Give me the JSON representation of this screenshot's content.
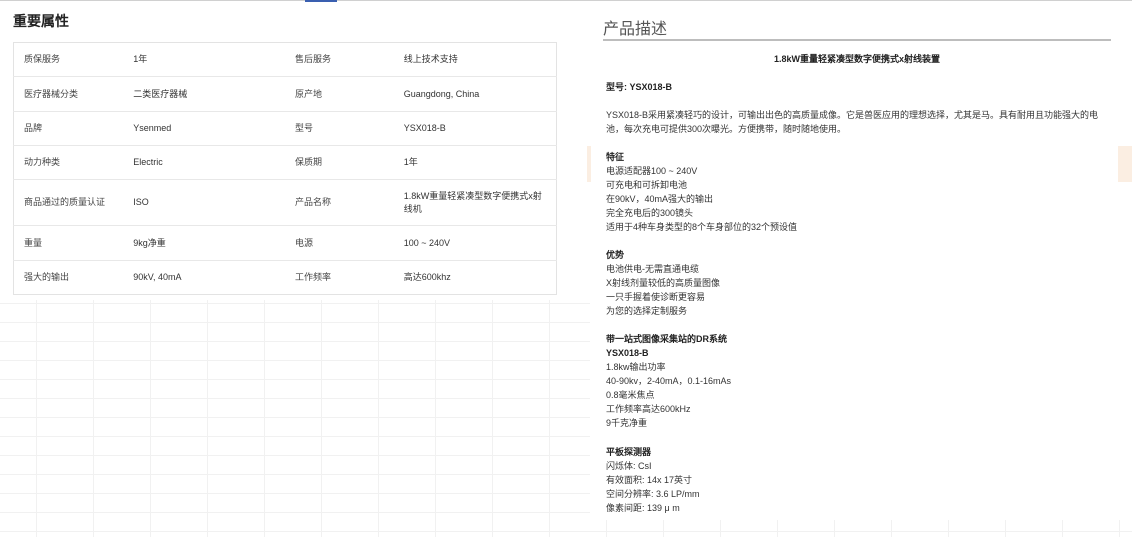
{
  "attributes": {
    "title": "重要属性",
    "rows": [
      {
        "k1": "质保服务",
        "v1": "1年",
        "k2": "售后服务",
        "v2": "线上技术支持"
      },
      {
        "k1": "医疗器械分类",
        "v1": "二类医疗器械",
        "k2": "原产地",
        "v2": "Guangdong, China"
      },
      {
        "k1": "品牌",
        "v1": "Ysenmed",
        "k2": "型号",
        "v2": "YSX018-B"
      },
      {
        "k1": "动力种类",
        "v1": "Electric",
        "k2": "保质期",
        "v2": "1年"
      },
      {
        "k1": "商品通过的质量认证",
        "v1": "ISO",
        "k2": "产品名称",
        "v2": "1.8kW重量轻紧凑型数字便携式x射线机"
      },
      {
        "k1": "重量",
        "v1": "9kg净重",
        "k2": "电源",
        "v2": "100 ~ 240V"
      },
      {
        "k1": "强大的输出",
        "v1": "90kV, 40mA",
        "k2": "工作频率",
        "v2": "高达600khz"
      }
    ]
  },
  "description": {
    "title": "产品描述",
    "heading": "1.8kW重量轻紧凑型数字便携式x射线装置",
    "model": "型号: YSX018-B",
    "intro": "YSX018-B采用紧凑轻巧的设计，可输出出色的高质量成像。它是兽医应用的理想选择，尤其是马。具有耐用且功能强大的电池，每次充电可提供300次曝光。方便携带，随时随地使用。",
    "features": {
      "title": "特征",
      "items": [
        "电源适配器100 ~ 240V",
        "可充电和可拆卸电池",
        "在90kV，40mA强大的输出",
        "完全充电后的300镜头",
        "适用于4种车身类型的8个车身部位的32个预设值"
      ]
    },
    "advantages": {
      "title": "优势",
      "items": [
        "电池供电-无需直通电缆",
        "X射线剂量较低的高质量图像",
        "一只手握着使诊断更容易",
        "为您的选择定制服务"
      ]
    },
    "dr_system": {
      "title": "带一站式图像采集站的DR系统",
      "subtitle": "YSX018-B",
      "items": [
        "1.8kw输出功率",
        "40-90kv，2-40mA，0.1-16mAs",
        "0.8毫米焦点",
        "工作频率高达600kHz",
        "9千克净重"
      ]
    },
    "detector": {
      "title": "平板探测器",
      "items": [
        "闪烁体: CsI",
        "有效面积: 14x 17英寸",
        "空间分辨率: 3.6 LP/mm",
        "像素间距: 139 μ m"
      ]
    }
  }
}
